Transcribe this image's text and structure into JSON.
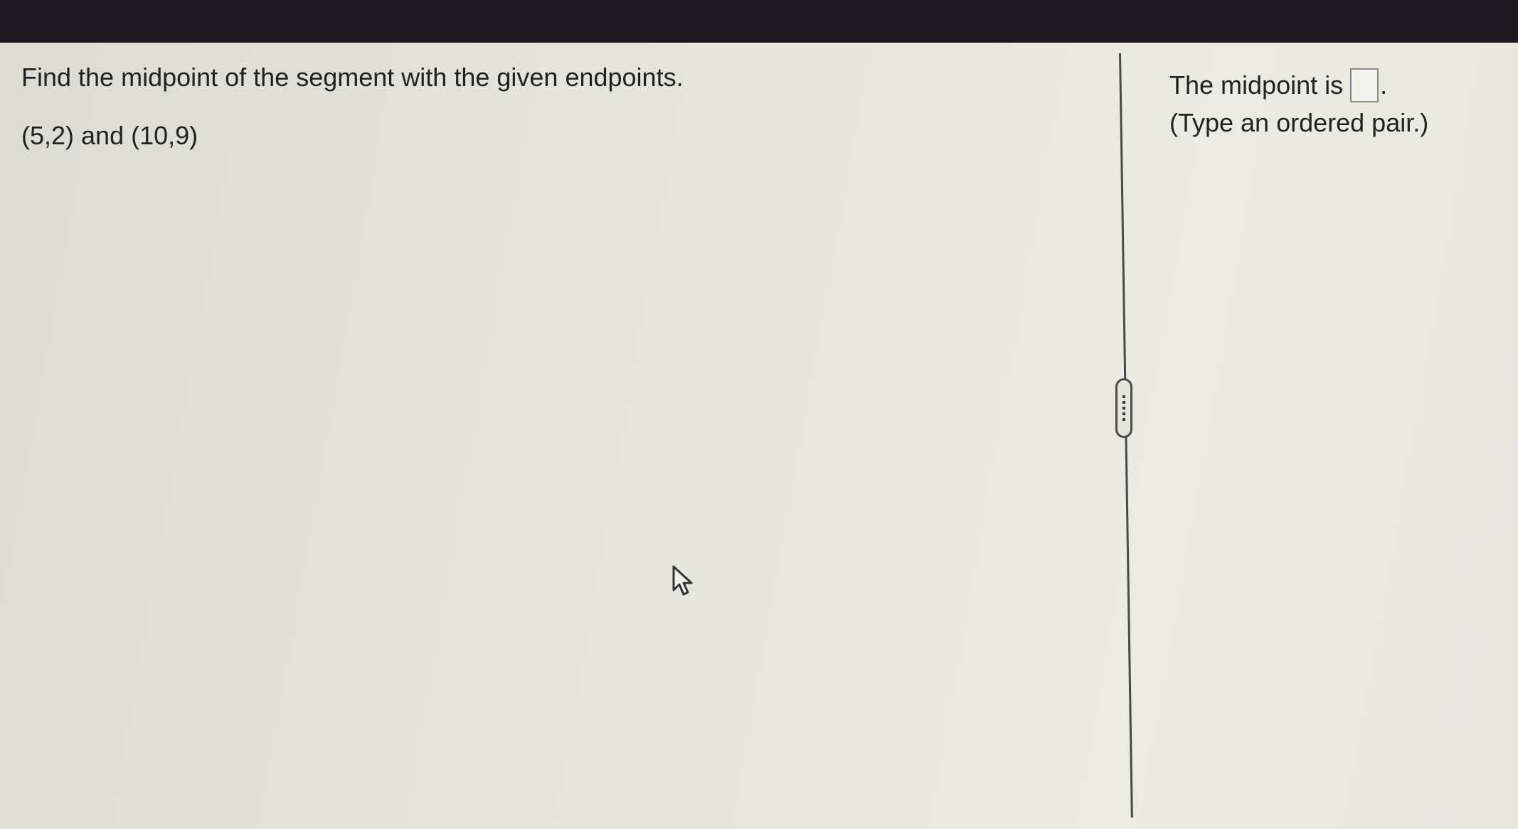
{
  "question": {
    "prompt": "Find the midpoint of the segment with the given endpoints.",
    "endpoints": "(5,2) and (10,9)"
  },
  "answer": {
    "label": "The midpoint is",
    "value": "",
    "period": ".",
    "hint": "(Type an ordered pair.)"
  },
  "colors": {
    "top_bar": "#1d1820",
    "background": "#e6e6dc",
    "text": "#222222",
    "divider": "#4a4a4a"
  },
  "icons": {
    "divider_handle": "drag-handle-icon",
    "pointer": "mouse-pointer-icon"
  }
}
